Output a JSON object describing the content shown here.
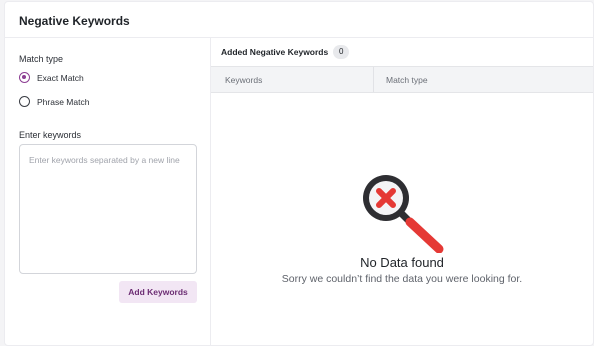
{
  "panel": {
    "title": "Negative Keywords"
  },
  "left": {
    "match_type_label": "Match type",
    "options": [
      {
        "label": "Exact Match",
        "selected": true
      },
      {
        "label": "Phrase Match",
        "selected": false
      }
    ],
    "keywords_label": "Enter keywords",
    "keywords_placeholder": "Enter keywords separated by a new line",
    "keywords_value": "",
    "add_button_label": "Add Keywords"
  },
  "right": {
    "added_label": "Added Negative Keywords",
    "count": "0",
    "columns": [
      "Keywords",
      "Match type"
    ],
    "empty": {
      "icon": "magnifier-x-icon",
      "title": "No Data found",
      "message": "Sorry we couldn’t find the data you were looking for."
    }
  },
  "colors": {
    "accent": "#8d3f93",
    "button_bg": "#f2e6f4",
    "button_text": "#6c2d73",
    "icon_red": "#e53935",
    "icon_dark": "#2e2e32"
  }
}
